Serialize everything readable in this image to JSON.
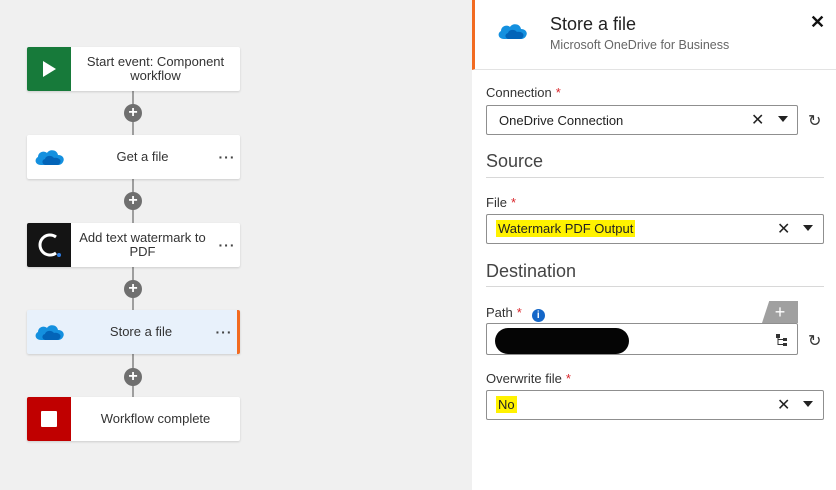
{
  "workflow": {
    "nodes": [
      {
        "label": "Start event: Component workflow",
        "icon": "play-icon",
        "menu": ""
      },
      {
        "label": "Get a file",
        "icon": "onedrive-cloud-icon",
        "menu": "···"
      },
      {
        "label": "Add text watermark to PDF",
        "icon": "converter-logo-icon",
        "menu": "···"
      },
      {
        "label": "Store a file",
        "icon": "onedrive-cloud-icon",
        "menu": "···"
      },
      {
        "label": "Workflow complete",
        "icon": "stop-icon",
        "menu": ""
      }
    ]
  },
  "panel": {
    "title": "Store a file",
    "subtitle": "Microsoft OneDrive for Business",
    "close_label": "✕",
    "connection": {
      "label": "Connection",
      "required": "*",
      "value": "OneDrive Connection"
    },
    "source_heading": "Source",
    "file": {
      "label": "File",
      "required": "*",
      "value": "Watermark PDF Output"
    },
    "destination_heading": "Destination",
    "path": {
      "label": "Path",
      "required": "*",
      "info": "i",
      "add": "+"
    },
    "overwrite": {
      "label": "Overwrite file",
      "required": "*",
      "value": "No"
    },
    "clear_glyph": "✕",
    "refresh_glyph": "↻"
  },
  "colors": {
    "accent": "#f26b21",
    "start_green": "#177a3a",
    "stop_red": "#c00000",
    "onedrive_blue": "#0f6cbd",
    "highlight": "#fff200"
  }
}
